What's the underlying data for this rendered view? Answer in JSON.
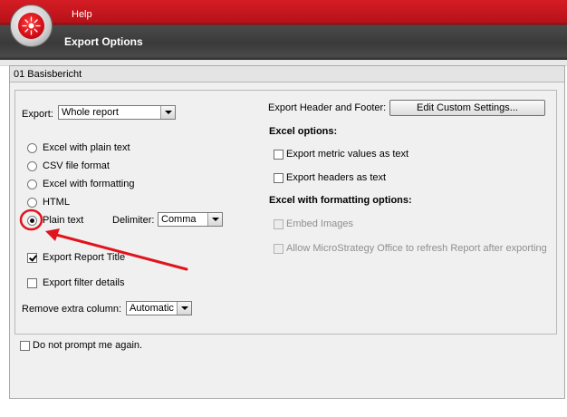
{
  "header": {
    "menu_help": "Help",
    "title": "Export Options"
  },
  "panel": {
    "title": "01 Basisbericht"
  },
  "export": {
    "label": "Export:",
    "selected": "Whole report"
  },
  "formats": [
    {
      "label": "Excel with plain text",
      "checked": false
    },
    {
      "label": "CSV file format",
      "checked": false
    },
    {
      "label": "Excel with formatting",
      "checked": false
    },
    {
      "label": "HTML",
      "checked": false
    },
    {
      "label": "Plain text",
      "checked": true
    }
  ],
  "delimiter": {
    "label": "Delimiter:",
    "selected": "Comma"
  },
  "options": {
    "export_report_title": "Export Report Title",
    "export_filter_details": "Export filter details",
    "remove_extra_column_label": "Remove extra column:",
    "remove_extra_column_value": "Automatic"
  },
  "right": {
    "header_footer_label": "Export Header and Footer:",
    "edit_button": "Edit Custom Settings...",
    "excel_options_heading": "Excel options:",
    "export_metric_values": "Export metric values as text",
    "export_headers": "Export headers as text",
    "excel_formatting_heading": "Excel with formatting options:",
    "embed_images": "Embed Images",
    "allow_office_refresh": "Allow MicroStrategy Office to refresh Report after exporting"
  },
  "footer": {
    "do_not_prompt": "Do not prompt me again."
  },
  "colors": {
    "annotation": "#e0141c",
    "brand_red": "#c8141c"
  }
}
